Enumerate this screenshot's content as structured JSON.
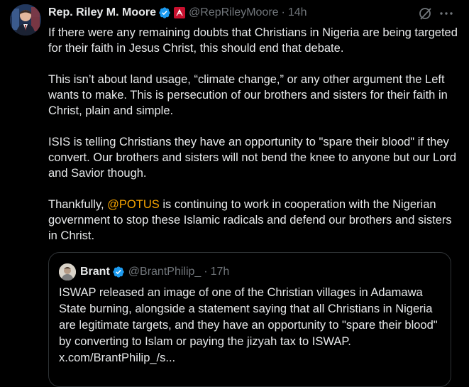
{
  "author": {
    "display_name": "Rep. Riley M. Moore",
    "handle": "@RepRileyMoore",
    "separator": "·",
    "time": "14h"
  },
  "tweet": {
    "paragraphs": [
      "If there were any remaining doubts that Christians in Nigeria are being targeted for their faith in Jesus Christ, this should end that debate.",
      "This isn’t about land usage, “climate change,” or any other argument the Left wants to make. This is persecution of our brothers and sisters for their faith in Christ, plain and simple.",
      "ISIS is telling Christians they have an opportunity to \"spare their blood\" if they convert. Our brothers and sisters will not bend the knee to anyone but our Lord and Savior though."
    ],
    "last_paragraph_prefix": "Thankfully, ",
    "mention": "@POTUS",
    "last_paragraph_suffix": " is continuing to work in cooperation with the Nigerian government to stop these Islamic radicals and defend our brothers and sisters in Christ."
  },
  "quote": {
    "display_name": "Brant",
    "handle": "@BrantPhilip_",
    "separator": "·",
    "time": "17h",
    "text": "ISWAP released an image of one of the Christian villages in Adamawa State burning, alongside a statement saying that all Christians in Nigeria are legitimate targets, and they have an opportunity to \"spare their blood\" by converting to Islam or paying the jizyah tax to ISWAP. x.com/BrantPhilip_/s..."
  },
  "colors": {
    "background": "#000000",
    "text": "#e7e9ea",
    "muted": "#71767b",
    "mention": "#f7a400",
    "verified_blue": "#1d9bf0",
    "affiliation_red": "#c8102e",
    "border": "#2f3336"
  },
  "icons": {
    "verified": "verified-badge-icon",
    "affiliation": "government-affiliation-icon",
    "grok": "grok-icon",
    "more": "more-options-icon"
  }
}
